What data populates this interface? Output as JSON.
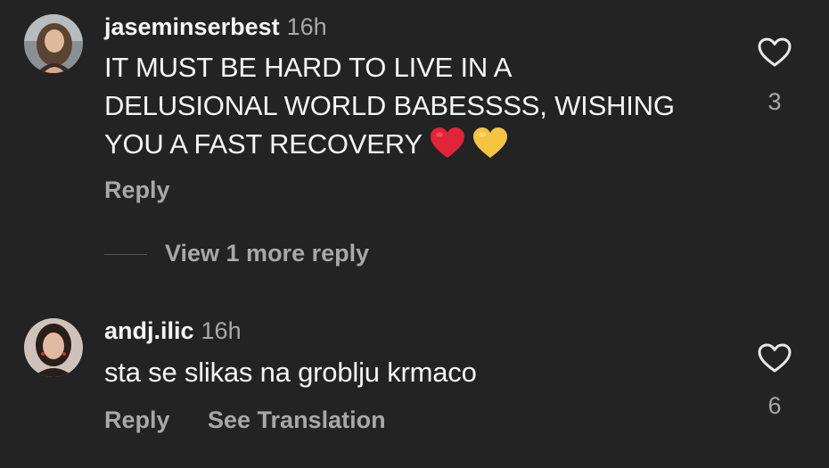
{
  "comments": [
    {
      "username": "jaseminserbest",
      "time": "16h",
      "text_lines": [
        "IT MUST BE HARD TO LIVE IN A",
        "DELUSIONAL WORLD BABESSSS, WISHING",
        "YOU A FAST RECOVERY"
      ],
      "emojis": [
        "red-heart",
        "yellow-heart"
      ],
      "reply_label": "Reply",
      "likes": "3",
      "view_more_label": "View 1 more reply"
    },
    {
      "username": "andj.ilic",
      "time": "16h",
      "text_lines": [
        "sta se slikas na groblju krmaco"
      ],
      "reply_label": "Reply",
      "translate_label": "See Translation",
      "likes": "6"
    }
  ],
  "icons": {
    "like": "heart-outline-icon"
  },
  "colors": {
    "background": "#232323",
    "primary_text": "#f5f5f5",
    "secondary_text": "#a8a8a8",
    "red_heart": "#e0243a",
    "yellow_heart": "#f6c343"
  }
}
